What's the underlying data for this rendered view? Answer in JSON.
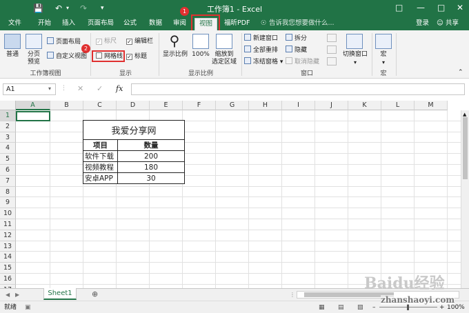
{
  "window": {
    "title": "工作簿1 - Excel"
  },
  "tabs": [
    "文件",
    "开始",
    "插入",
    "页面布局",
    "公式",
    "数据",
    "审阅",
    "视图",
    "福昕PDF"
  ],
  "tell_me": "告诉我您想要做什么...",
  "account": {
    "signin": "登录",
    "share": "共享"
  },
  "annotations": {
    "one": "1",
    "two": "2"
  },
  "ribbon": {
    "normal": "普通",
    "page_break_1": "分页",
    "page_break_2": "预览",
    "page_layout": "页面布局",
    "custom_views": "自定义视图",
    "group_workbook_views": "工作簿视图",
    "ruler": "标尺",
    "formula_bar": "编辑栏",
    "gridlines": "网格线",
    "headings": "标题",
    "group_show": "显示",
    "zoom": "显示比例",
    "zoom100": "100%",
    "zoom_selection_1": "缩放到",
    "zoom_selection_2": "选定区域",
    "group_zoom": "显示比例",
    "new_window": "新建窗口",
    "arrange_all": "全部重排",
    "freeze_panes": "冻结窗格",
    "split": "拆分",
    "hide": "隐藏",
    "unhide": "取消隐藏",
    "switch_windows": "切换窗口",
    "group_window": "窗口",
    "macros": "宏",
    "group_macros": "宏"
  },
  "formula_bar": {
    "name_box": "A1",
    "fx": "fx",
    "value": ""
  },
  "columns": [
    "A",
    "B",
    "C",
    "D",
    "E",
    "F",
    "G",
    "H",
    "I",
    "J",
    "K",
    "L",
    "M"
  ],
  "rows": [
    "1",
    "2",
    "3",
    "4",
    "5",
    "6",
    "7",
    "8",
    "9",
    "10",
    "11",
    "12",
    "13",
    "14",
    "15",
    "16",
    "17",
    "18"
  ],
  "table": {
    "title": "我爱分享网",
    "headers": [
      "项目",
      "数量"
    ],
    "rows": [
      [
        "软件下载",
        "200"
      ],
      [
        "视频教程",
        "180"
      ],
      [
        "安卓APP",
        "30"
      ]
    ]
  },
  "sheet_tabs": [
    "Sheet1"
  ],
  "status": {
    "ready": "就绪",
    "zoom": "100%"
  },
  "watermark": {
    "brand": "Baidu经验",
    "site": "zhanshaoyi.com"
  }
}
